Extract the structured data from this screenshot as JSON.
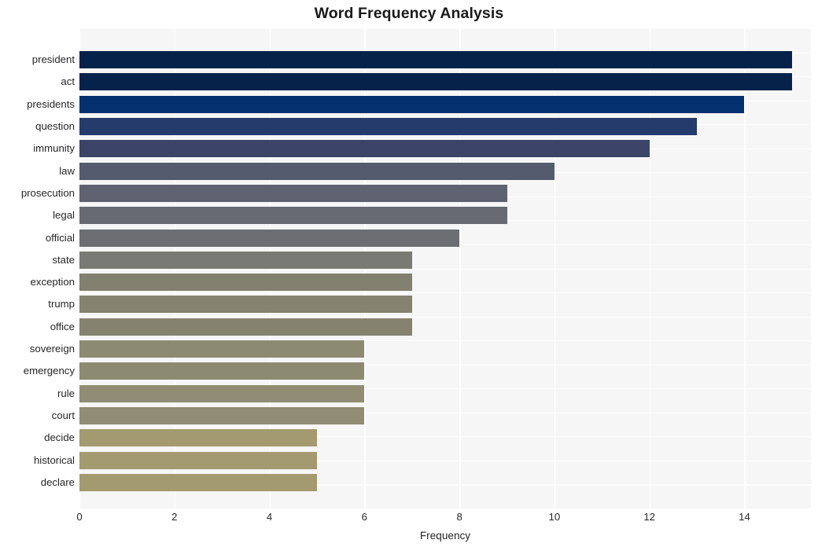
{
  "chart_data": {
    "type": "bar",
    "orientation": "horizontal",
    "title": "Word Frequency Analysis",
    "xlabel": "Frequency",
    "ylabel": "",
    "xlim": [
      0,
      15.4
    ],
    "ylim": [
      0,
      20
    ],
    "grid": true,
    "legend": null,
    "xticks": [
      0,
      2,
      4,
      6,
      8,
      10,
      12,
      14
    ],
    "xtick_labels": [
      "0",
      "2",
      "4",
      "6",
      "8",
      "10",
      "12",
      "14"
    ],
    "categories": [
      "president",
      "act",
      "presidents",
      "question",
      "immunity",
      "law",
      "prosecution",
      "legal",
      "official",
      "state",
      "exception",
      "trump",
      "office",
      "sovereign",
      "emergency",
      "rule",
      "court",
      "decide",
      "historical",
      "declare"
    ],
    "values": [
      15,
      15,
      14,
      13,
      12,
      10,
      9,
      9,
      8,
      7,
      7,
      7,
      7,
      6,
      6,
      6,
      6,
      5,
      5,
      5
    ],
    "bar_colors": [
      "#05224a",
      "#05224a",
      "#03306f",
      "#243b6b",
      "#3b4468",
      "#555b6e",
      "#5f6270",
      "#676a72",
      "#6c6e72",
      "#7a7a74",
      "#82806f",
      "#85836f",
      "#85836f",
      "#8d8a72",
      "#8d8a72",
      "#908d74",
      "#908d74",
      "#a39a70",
      "#a39a70",
      "#a39a70"
    ],
    "plot_background": "#f6f6f7",
    "figure_background": "#ffffff",
    "gridline_color": "#ffffff"
  }
}
